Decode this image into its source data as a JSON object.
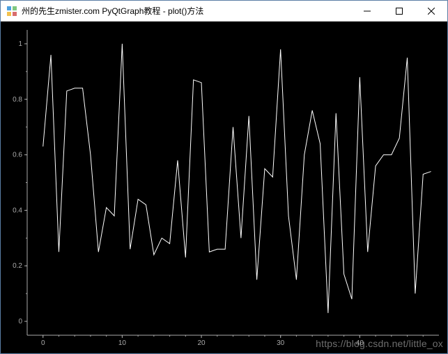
{
  "window": {
    "title": "州的先生zmister.com PyQtGraph教程 - plot()方法"
  },
  "watermark": "https://blog.csdn.net/little_ox",
  "chart_data": {
    "type": "line",
    "title": "",
    "xlabel": "",
    "ylabel": "",
    "xlim": [
      -2,
      50
    ],
    "ylim": [
      -0.05,
      1.05
    ],
    "x_ticks": [
      0,
      10,
      20,
      30,
      40
    ],
    "y_ticks": [
      0,
      0.2,
      0.4,
      0.6,
      0.8,
      1.0
    ],
    "y_tick_labels": [
      "0",
      "0.2",
      "0.4",
      "0.6",
      "0.8",
      "1"
    ],
    "x": [
      0,
      1,
      2,
      3,
      4,
      5,
      6,
      7,
      8,
      9,
      10,
      11,
      12,
      13,
      14,
      15,
      16,
      17,
      18,
      19,
      20,
      21,
      22,
      23,
      24,
      25,
      26,
      27,
      28,
      29,
      30,
      31,
      32,
      33,
      34,
      35,
      36,
      37,
      38,
      39,
      40,
      41,
      42,
      43,
      44,
      45,
      46,
      47,
      48,
      49
    ],
    "values": [
      0.63,
      0.96,
      0.25,
      0.83,
      0.84,
      0.84,
      0.6,
      0.25,
      0.41,
      0.38,
      1.0,
      0.26,
      0.44,
      0.42,
      0.24,
      0.3,
      0.28,
      0.58,
      0.23,
      0.87,
      0.86,
      0.25,
      0.26,
      0.26,
      0.7,
      0.3,
      0.74,
      0.15,
      0.55,
      0.52,
      0.98,
      0.38,
      0.15,
      0.6,
      0.76,
      0.64,
      0.03,
      0.75,
      0.17,
      0.08,
      0.88,
      0.25,
      0.56,
      0.6,
      0.6,
      0.66,
      0.95,
      0.1,
      0.53,
      0.54
    ]
  }
}
